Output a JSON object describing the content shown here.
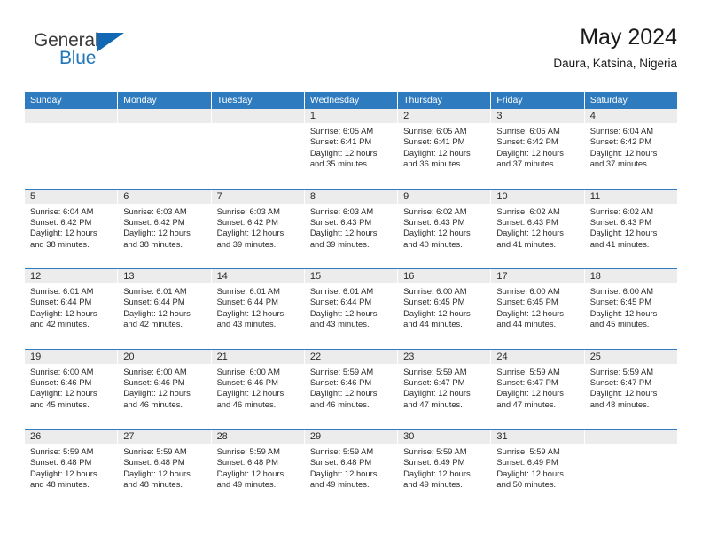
{
  "brand": {
    "name_top": "General",
    "name_bottom": "Blue",
    "accent_color": "#2277bb",
    "triangle_color": "#1268b3"
  },
  "header": {
    "title": "May 2024",
    "subtitle": "Daura, Katsina, Nigeria"
  },
  "calendar": {
    "header_bg": "#2f7bbf",
    "daynum_bg": "#ececec",
    "weekday_names": [
      "Sunday",
      "Monday",
      "Tuesday",
      "Wednesday",
      "Thursday",
      "Friday",
      "Saturday"
    ],
    "labels": {
      "sunrise": "Sunrise:",
      "sunset": "Sunset:",
      "daylight": "Daylight:"
    },
    "weeks": [
      [
        {
          "day": "",
          "empty": true
        },
        {
          "day": "",
          "empty": true
        },
        {
          "day": "",
          "empty": true
        },
        {
          "day": "1",
          "sunrise": "Sunrise: 6:05 AM",
          "sunset": "Sunset: 6:41 PM",
          "daylight": "Daylight: 12 hours and 35 minutes."
        },
        {
          "day": "2",
          "sunrise": "Sunrise: 6:05 AM",
          "sunset": "Sunset: 6:41 PM",
          "daylight": "Daylight: 12 hours and 36 minutes."
        },
        {
          "day": "3",
          "sunrise": "Sunrise: 6:05 AM",
          "sunset": "Sunset: 6:42 PM",
          "daylight": "Daylight: 12 hours and 37 minutes."
        },
        {
          "day": "4",
          "sunrise": "Sunrise: 6:04 AM",
          "sunset": "Sunset: 6:42 PM",
          "daylight": "Daylight: 12 hours and 37 minutes."
        }
      ],
      [
        {
          "day": "5",
          "sunrise": "Sunrise: 6:04 AM",
          "sunset": "Sunset: 6:42 PM",
          "daylight": "Daylight: 12 hours and 38 minutes."
        },
        {
          "day": "6",
          "sunrise": "Sunrise: 6:03 AM",
          "sunset": "Sunset: 6:42 PM",
          "daylight": "Daylight: 12 hours and 38 minutes."
        },
        {
          "day": "7",
          "sunrise": "Sunrise: 6:03 AM",
          "sunset": "Sunset: 6:42 PM",
          "daylight": "Daylight: 12 hours and 39 minutes."
        },
        {
          "day": "8",
          "sunrise": "Sunrise: 6:03 AM",
          "sunset": "Sunset: 6:43 PM",
          "daylight": "Daylight: 12 hours and 39 minutes."
        },
        {
          "day": "9",
          "sunrise": "Sunrise: 6:02 AM",
          "sunset": "Sunset: 6:43 PM",
          "daylight": "Daylight: 12 hours and 40 minutes."
        },
        {
          "day": "10",
          "sunrise": "Sunrise: 6:02 AM",
          "sunset": "Sunset: 6:43 PM",
          "daylight": "Daylight: 12 hours and 41 minutes."
        },
        {
          "day": "11",
          "sunrise": "Sunrise: 6:02 AM",
          "sunset": "Sunset: 6:43 PM",
          "daylight": "Daylight: 12 hours and 41 minutes."
        }
      ],
      [
        {
          "day": "12",
          "sunrise": "Sunrise: 6:01 AM",
          "sunset": "Sunset: 6:44 PM",
          "daylight": "Daylight: 12 hours and 42 minutes."
        },
        {
          "day": "13",
          "sunrise": "Sunrise: 6:01 AM",
          "sunset": "Sunset: 6:44 PM",
          "daylight": "Daylight: 12 hours and 42 minutes."
        },
        {
          "day": "14",
          "sunrise": "Sunrise: 6:01 AM",
          "sunset": "Sunset: 6:44 PM",
          "daylight": "Daylight: 12 hours and 43 minutes."
        },
        {
          "day": "15",
          "sunrise": "Sunrise: 6:01 AM",
          "sunset": "Sunset: 6:44 PM",
          "daylight": "Daylight: 12 hours and 43 minutes."
        },
        {
          "day": "16",
          "sunrise": "Sunrise: 6:00 AM",
          "sunset": "Sunset: 6:45 PM",
          "daylight": "Daylight: 12 hours and 44 minutes."
        },
        {
          "day": "17",
          "sunrise": "Sunrise: 6:00 AM",
          "sunset": "Sunset: 6:45 PM",
          "daylight": "Daylight: 12 hours and 44 minutes."
        },
        {
          "day": "18",
          "sunrise": "Sunrise: 6:00 AM",
          "sunset": "Sunset: 6:45 PM",
          "daylight": "Daylight: 12 hours and 45 minutes."
        }
      ],
      [
        {
          "day": "19",
          "sunrise": "Sunrise: 6:00 AM",
          "sunset": "Sunset: 6:46 PM",
          "daylight": "Daylight: 12 hours and 45 minutes."
        },
        {
          "day": "20",
          "sunrise": "Sunrise: 6:00 AM",
          "sunset": "Sunset: 6:46 PM",
          "daylight": "Daylight: 12 hours and 46 minutes."
        },
        {
          "day": "21",
          "sunrise": "Sunrise: 6:00 AM",
          "sunset": "Sunset: 6:46 PM",
          "daylight": "Daylight: 12 hours and 46 minutes."
        },
        {
          "day": "22",
          "sunrise": "Sunrise: 5:59 AM",
          "sunset": "Sunset: 6:46 PM",
          "daylight": "Daylight: 12 hours and 46 minutes."
        },
        {
          "day": "23",
          "sunrise": "Sunrise: 5:59 AM",
          "sunset": "Sunset: 6:47 PM",
          "daylight": "Daylight: 12 hours and 47 minutes."
        },
        {
          "day": "24",
          "sunrise": "Sunrise: 5:59 AM",
          "sunset": "Sunset: 6:47 PM",
          "daylight": "Daylight: 12 hours and 47 minutes."
        },
        {
          "day": "25",
          "sunrise": "Sunrise: 5:59 AM",
          "sunset": "Sunset: 6:47 PM",
          "daylight": "Daylight: 12 hours and 48 minutes."
        }
      ],
      [
        {
          "day": "26",
          "sunrise": "Sunrise: 5:59 AM",
          "sunset": "Sunset: 6:48 PM",
          "daylight": "Daylight: 12 hours and 48 minutes."
        },
        {
          "day": "27",
          "sunrise": "Sunrise: 5:59 AM",
          "sunset": "Sunset: 6:48 PM",
          "daylight": "Daylight: 12 hours and 48 minutes."
        },
        {
          "day": "28",
          "sunrise": "Sunrise: 5:59 AM",
          "sunset": "Sunset: 6:48 PM",
          "daylight": "Daylight: 12 hours and 49 minutes."
        },
        {
          "day": "29",
          "sunrise": "Sunrise: 5:59 AM",
          "sunset": "Sunset: 6:48 PM",
          "daylight": "Daylight: 12 hours and 49 minutes."
        },
        {
          "day": "30",
          "sunrise": "Sunrise: 5:59 AM",
          "sunset": "Sunset: 6:49 PM",
          "daylight": "Daylight: 12 hours and 49 minutes."
        },
        {
          "day": "31",
          "sunrise": "Sunrise: 5:59 AM",
          "sunset": "Sunset: 6:49 PM",
          "daylight": "Daylight: 12 hours and 50 minutes."
        },
        {
          "day": "",
          "empty": true
        }
      ]
    ]
  }
}
